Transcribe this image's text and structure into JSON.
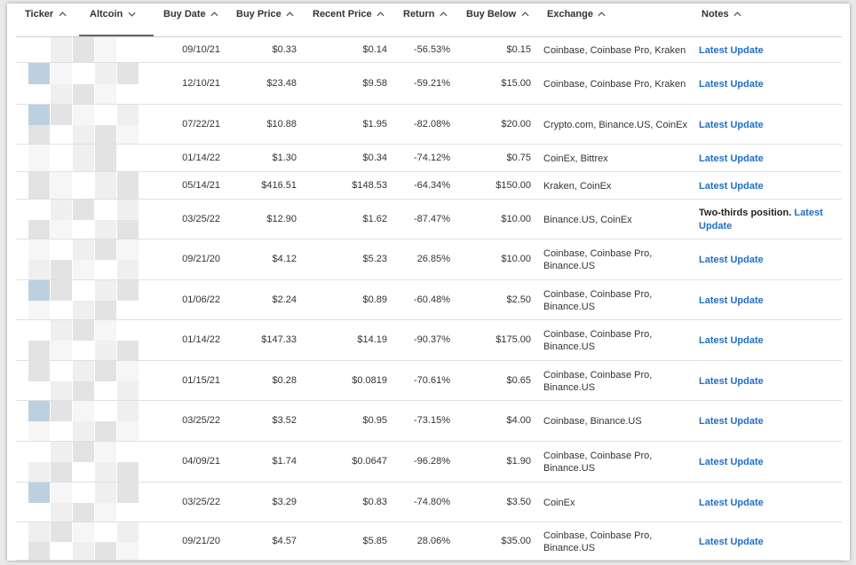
{
  "table": {
    "columns": [
      {
        "key": "ticker",
        "label": "Ticker",
        "sort": "up"
      },
      {
        "key": "altcoin",
        "label": "Altcoin",
        "sort": "down"
      },
      {
        "key": "buy_date",
        "label": "Buy Date",
        "sort": "up"
      },
      {
        "key": "buy_price",
        "label": "Buy Price",
        "sort": "up"
      },
      {
        "key": "recent_price",
        "label": "Recent Price",
        "sort": "up"
      },
      {
        "key": "return",
        "label": "Return",
        "sort": "up"
      },
      {
        "key": "buy_below",
        "label": "Buy Below",
        "sort": "up"
      },
      {
        "key": "exchange",
        "label": "Exchange",
        "sort": "up"
      },
      {
        "key": "notes",
        "label": "Notes",
        "sort": "up"
      }
    ],
    "rows": [
      {
        "buy_date": "09/10/21",
        "buy_price": "$0.33",
        "recent_price": "$0.14",
        "return": "-56.53%",
        "buy_below": "$0.15",
        "exchange": "Coinbase, Coinbase Pro, Kraken",
        "note_prefix": "",
        "note_link": "Latest Update"
      },
      {
        "buy_date": "12/10/21",
        "buy_price": "$23.48",
        "recent_price": "$9.58",
        "return": "-59.21%",
        "buy_below": "$15.00",
        "exchange": "Coinbase, Coinbase Pro, Kraken",
        "note_prefix": "",
        "note_link": "Latest Update"
      },
      {
        "buy_date": "07/22/21",
        "buy_price": "$10.88",
        "recent_price": "$1.95",
        "return": "-82.08%",
        "buy_below": "$20.00",
        "exchange": "Crypto.com, Binance.US, CoinEx",
        "note_prefix": "",
        "note_link": "Latest Update"
      },
      {
        "buy_date": "01/14/22",
        "buy_price": "$1.30",
        "recent_price": "$0.34",
        "return": "-74.12%",
        "buy_below": "$0.75",
        "exchange": "CoinEx, Bittrex",
        "note_prefix": "",
        "note_link": "Latest Update"
      },
      {
        "buy_date": "05/14/21",
        "buy_price": "$416.51",
        "recent_price": "$148.53",
        "return": "-64.34%",
        "buy_below": "$150.00",
        "exchange": "Kraken, CoinEx",
        "note_prefix": "",
        "note_link": "Latest Update"
      },
      {
        "buy_date": "03/25/22",
        "buy_price": "$12.90",
        "recent_price": "$1.62",
        "return": "-87.47%",
        "buy_below": "$10.00",
        "exchange": "Binance.US, CoinEx",
        "note_prefix": "Two-thirds position.",
        "note_link": "Latest Update"
      },
      {
        "buy_date": "09/21/20",
        "buy_price": "$4.12",
        "recent_price": "$5.23",
        "return": "26.85%",
        "buy_below": "$10.00",
        "exchange": "Coinbase, Coinbase Pro, Binance.US",
        "note_prefix": "",
        "note_link": "Latest Update"
      },
      {
        "buy_date": "01/06/22",
        "buy_price": "$2.24",
        "recent_price": "$0.89",
        "return": "-60.48%",
        "buy_below": "$2.50",
        "exchange": "Coinbase, Coinbase Pro, Binance.US",
        "note_prefix": "",
        "note_link": "Latest Update"
      },
      {
        "buy_date": "01/14/22",
        "buy_price": "$147.33",
        "recent_price": "$14.19",
        "return": "-90.37%",
        "buy_below": "$175.00",
        "exchange": "Coinbase, Coinbase Pro, Binance.US",
        "note_prefix": "",
        "note_link": "Latest Update"
      },
      {
        "buy_date": "01/15/21",
        "buy_price": "$0.28",
        "recent_price": "$0.0819",
        "return": "-70.61%",
        "buy_below": "$0.65",
        "exchange": "Coinbase, Coinbase Pro, Binance.US",
        "note_prefix": "",
        "note_link": "Latest Update"
      },
      {
        "buy_date": "03/25/22",
        "buy_price": "$3.52",
        "recent_price": "$0.95",
        "return": "-73.15%",
        "buy_below": "$4.00",
        "exchange": "Coinbase, Binance.US",
        "note_prefix": "",
        "note_link": "Latest Update"
      },
      {
        "buy_date": "04/09/21",
        "buy_price": "$1.74",
        "recent_price": "$0.0647",
        "return": "-96.28%",
        "buy_below": "$1.90",
        "exchange": "Coinbase, Coinbase Pro, Binance.US",
        "note_prefix": "",
        "note_link": "Latest Update"
      },
      {
        "buy_date": "03/25/22",
        "buy_price": "$3.29",
        "recent_price": "$0.83",
        "return": "-74.80%",
        "buy_below": "$3.50",
        "exchange": "CoinEx",
        "note_prefix": "",
        "note_link": "Latest Update"
      },
      {
        "buy_date": "09/21/20",
        "buy_price": "$4.57",
        "recent_price": "$5.85",
        "return": "28.06%",
        "buy_below": "$35.00",
        "exchange": "Coinbase, Coinbase Pro, Binance.US",
        "note_prefix": "",
        "note_link": "Latest Update"
      }
    ]
  },
  "colors": {
    "link": "#1f6fc6",
    "text": "#333333",
    "blur_light": "#ececec",
    "blur_mid": "#dcdcdc",
    "blur_blue": "#bcd0e0"
  }
}
